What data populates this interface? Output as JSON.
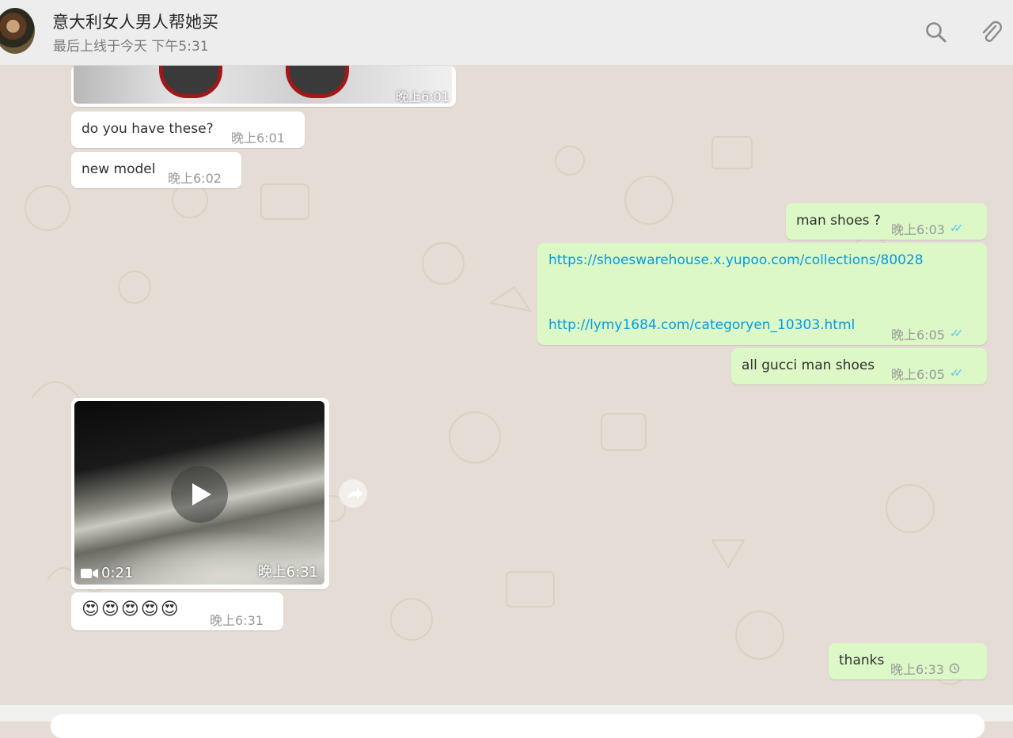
{
  "header": {
    "contact_name": "意大利女人男人帮她买",
    "status": "最后上线于今天 下午5:31",
    "search_icon": "search-icon",
    "attach_icon": "paperclip-icon"
  },
  "messages": [
    {
      "id": "m0",
      "direction": "in",
      "type": "image",
      "time": "晚上6:01"
    },
    {
      "id": "m1",
      "direction": "in",
      "type": "text",
      "text": "do you have these?",
      "time": "晚上6:01"
    },
    {
      "id": "m2",
      "direction": "in",
      "type": "text",
      "text": "new model",
      "time": "晚上6:02"
    },
    {
      "id": "m3",
      "direction": "out",
      "type": "text",
      "text": "man shoes ?",
      "time": "晚上6:03",
      "status": "read"
    },
    {
      "id": "m4",
      "direction": "out",
      "type": "links",
      "links": [
        "https://shoeswarehouse.x.yupoo.com/collections/80028",
        "http://lymy1684.com/categoryen_10303.html"
      ],
      "time": "晚上6:05",
      "status": "read"
    },
    {
      "id": "m5",
      "direction": "out",
      "type": "text",
      "text": "all gucci man shoes",
      "time": "晚上6:05",
      "status": "read"
    },
    {
      "id": "m6",
      "direction": "in",
      "type": "video",
      "duration": "0:21",
      "time": "晚上6:31"
    },
    {
      "id": "m7",
      "direction": "in",
      "type": "text",
      "text": "😍😍😍😍😍",
      "time": "晚上6:31"
    },
    {
      "id": "m8",
      "direction": "out",
      "type": "text",
      "text": "thanks",
      "time": "晚上6:33",
      "status": "pending"
    }
  ],
  "colors": {
    "chat_bg": "#e5ddd5",
    "incoming": "#ffffff",
    "outgoing": "#dcf8c6",
    "link": "#039be5",
    "read_ticks": "#4fc3f7"
  }
}
